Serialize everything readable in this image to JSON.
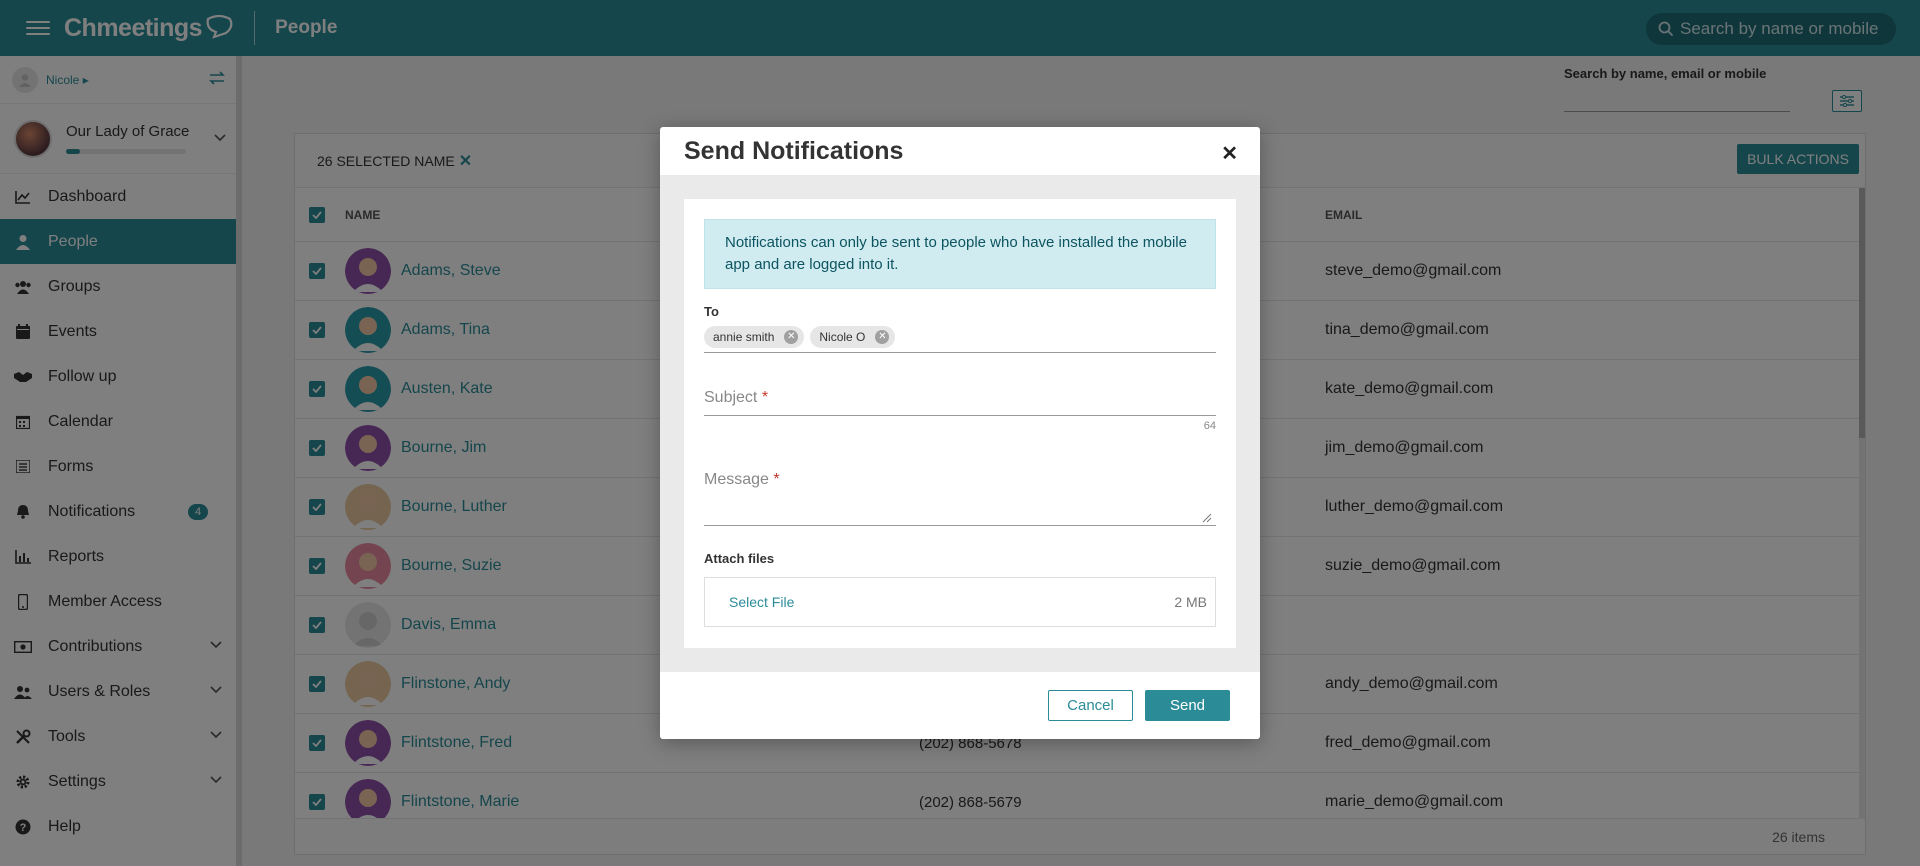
{
  "topbar": {
    "app_name": "Chmeetings",
    "page_title": "People",
    "search_placeholder": "Search by name or mobile"
  },
  "sidebar": {
    "user_name": "Nicole",
    "org_name": "Our Lady of Grace",
    "org_progress": 0.12,
    "items": [
      {
        "label": "Dashboard",
        "icon": "chart-line-icon"
      },
      {
        "label": "People",
        "icon": "person-icon",
        "active": true
      },
      {
        "label": "Groups",
        "icon": "users-icon"
      },
      {
        "label": "Events",
        "icon": "calendar-icon"
      },
      {
        "label": "Follow up",
        "icon": "handshake-icon"
      },
      {
        "label": "Calendar",
        "icon": "calendar-grid-icon"
      },
      {
        "label": "Forms",
        "icon": "list-icon"
      },
      {
        "label": "Notifications",
        "icon": "bell-icon",
        "badge": "4"
      },
      {
        "label": "Reports",
        "icon": "bar-chart-icon"
      },
      {
        "label": "Member Access",
        "icon": "mobile-icon"
      },
      {
        "label": "Contributions",
        "icon": "money-icon",
        "expandable": true
      },
      {
        "label": "Users & Roles",
        "icon": "user-group-icon",
        "expandable": true
      },
      {
        "label": "Tools",
        "icon": "tools-icon",
        "expandable": true
      },
      {
        "label": "Settings",
        "icon": "gear-icon",
        "expandable": true
      },
      {
        "label": "Help",
        "icon": "question-icon"
      }
    ]
  },
  "main": {
    "search_label": "Search by name, email or mobile",
    "selected_label": "26 SELECTED NAME",
    "bulk_actions": "BULK ACTIONS",
    "columns": {
      "name": "NAME",
      "email": "EMAIL"
    },
    "rows": [
      {
        "name": "Adams, Steve",
        "phone": "",
        "email": "steve_demo@gmail.com",
        "color": "#8e4fa8"
      },
      {
        "name": "Adams, Tina",
        "phone": "",
        "email": "tina_demo@gmail.com",
        "color": "#2b9aa8"
      },
      {
        "name": "Austen, Kate",
        "phone": "",
        "email": "kate_demo@gmail.com",
        "color": "#2b9aa8"
      },
      {
        "name": "Bourne, Jim",
        "phone": "",
        "email": "jim_demo@gmail.com",
        "color": "#8e4fa8"
      },
      {
        "name": "Bourne, Luther",
        "phone": "",
        "email": "luther_demo@gmail.com",
        "color": "#e8c9a0"
      },
      {
        "name": "Bourne, Suzie",
        "phone": "",
        "email": "suzie_demo@gmail.com",
        "color": "#e88aa0"
      },
      {
        "name": "Davis, Emma",
        "phone": "",
        "email": "",
        "color": "#e6e6e6"
      },
      {
        "name": "Flinstone, Andy",
        "phone": "",
        "email": "andy_demo@gmail.com",
        "color": "#e8c9a0"
      },
      {
        "name": "Flintstone, Fred",
        "phone": "(202) 868-5678",
        "email": "fred_demo@gmail.com",
        "color": "#8e4fa8"
      },
      {
        "name": "Flintstone, Marie",
        "phone": "(202) 868-5679",
        "email": "marie_demo@gmail.com",
        "color": "#8e4fa8"
      }
    ],
    "item_count": "26 items"
  },
  "modal": {
    "title": "Send Notifications",
    "info": "Notifications can only be sent to people who have installed the mobile app and are logged into it.",
    "to_label": "To",
    "recipients": [
      "annie smith",
      "Nicole O"
    ],
    "subject_label": "Subject",
    "subject_counter": "64",
    "message_label": "Message",
    "attach_label": "Attach files",
    "select_file": "Select File",
    "max_size": "2 MB",
    "cancel": "Cancel",
    "send": "Send"
  }
}
